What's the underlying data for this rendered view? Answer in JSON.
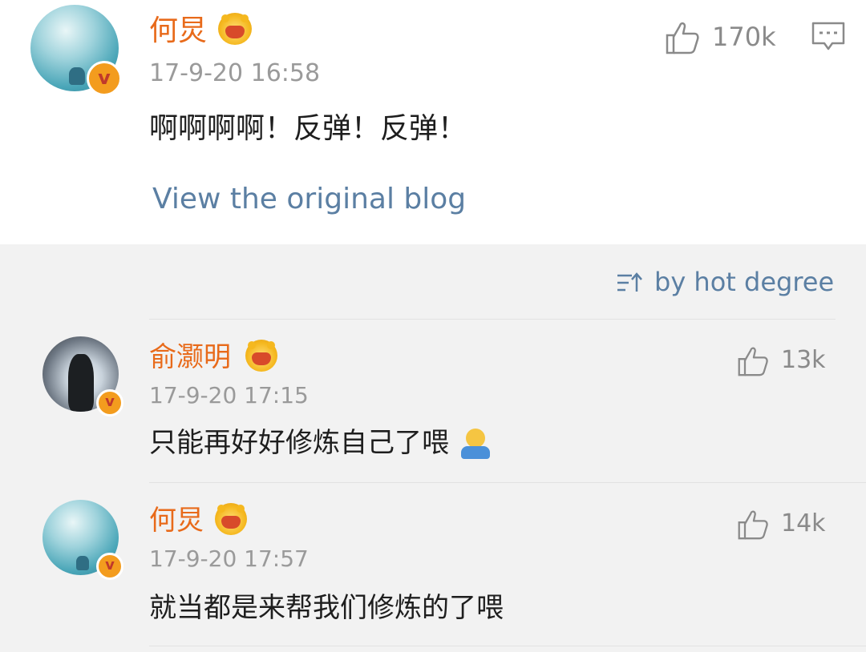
{
  "post": {
    "author": "何炅",
    "time": "17-9-20 16:58",
    "text": "啊啊啊啊！反弹！反弹！",
    "likes": "170k",
    "view_original": "View the original blog"
  },
  "sort": {
    "label": "by hot degree"
  },
  "comments": [
    {
      "author": "俞灏明",
      "time": "17-9-20 17:15",
      "text": "只能再好好修炼自己了喂",
      "likes": "13k"
    },
    {
      "author": "何炅",
      "time": "17-9-20 17:57",
      "text": "就当都是来帮我们修炼的了喂",
      "likes": "14k"
    }
  ],
  "badge": {
    "letter": "v"
  },
  "colors": {
    "name": "#e86a1a",
    "link": "#5b7fa3",
    "badge": "#f39c1e"
  },
  "icons": [
    "thumbs-up-icon",
    "comment-icon",
    "sort-icon",
    "crown-emoji",
    "shrug-emoji"
  ]
}
